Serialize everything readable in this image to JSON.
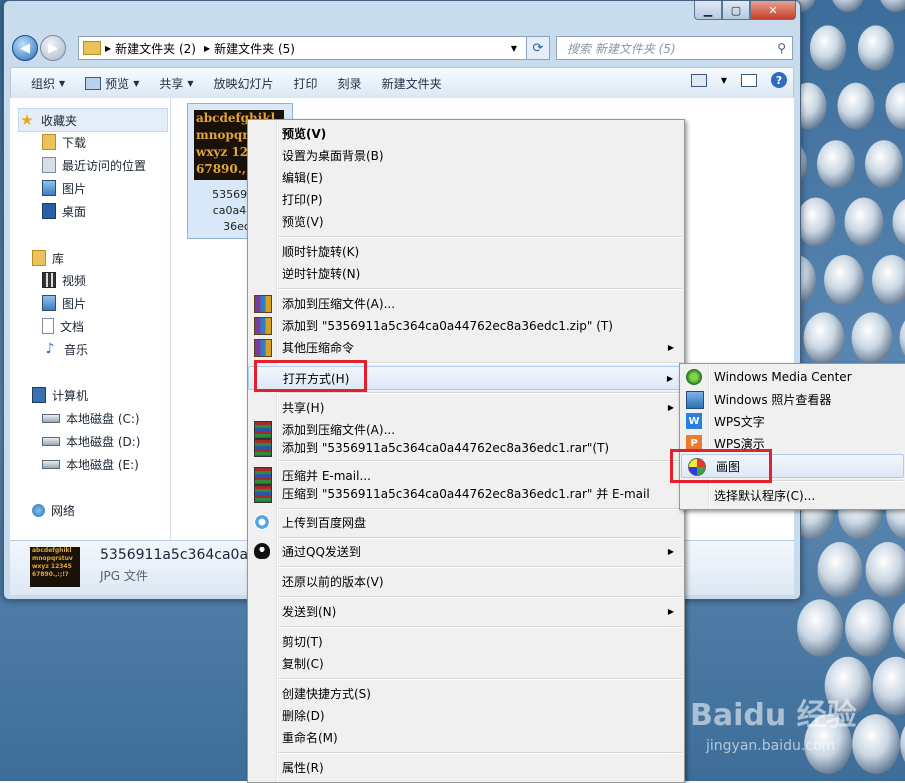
{
  "address": {
    "segments": [
      "新建文件夹 (2)",
      "新建文件夹 (5)"
    ]
  },
  "search": {
    "placeholder": "搜索 新建文件夹 (5)"
  },
  "toolbar": {
    "organize": "组织",
    "preview": "预览",
    "share": "共享",
    "slideshow": "放映幻灯片",
    "print": "打印",
    "burn": "刻录",
    "new_folder": "新建文件夹"
  },
  "sidebar": {
    "favorites": "收藏夹",
    "downloads": "下载",
    "recent": "最近访问的位置",
    "pictures_fav": "图片",
    "desktop": "桌面",
    "libraries": "库",
    "videos": "视频",
    "pictures": "图片",
    "documents": "文档",
    "music": "音乐",
    "computer": "计算机",
    "disk_c": "本地磁盘 (C:)",
    "disk_d": "本地磁盘 (D:)",
    "disk_e": "本地磁盘 (E:)",
    "network": "网络"
  },
  "file": {
    "thumb_lines": [
      "abcdefghikl",
      "mnopqrst",
      "wxyz 123",
      "67890.,"
    ],
    "name_lines": [
      "5356911a",
      "ca0a4476",
      "36edc"
    ]
  },
  "details": {
    "thumb_lines": [
      "abcdefghikl",
      "mnopqrstuv",
      "wxyz 12345",
      "67890.,:;!?"
    ],
    "name": "5356911a5c364ca0a447",
    "type": "JPG 文件"
  },
  "menu": {
    "preview_bold": "预览(V)",
    "set_desktop_bg": "设置为桌面背景(B)",
    "edit": "编辑(E)",
    "print": "打印(P)",
    "preview": "预览(V)",
    "rotate_cw": "顺时针旋转(K)",
    "rotate_ccw": "逆时针旋转(N)",
    "add_archive": "添加到压缩文件(A)...",
    "add_zip": "添加到 \"5356911a5c364ca0a44762ec8a36edc1.zip\" (T)",
    "other_compress": "其他压缩命令",
    "open_with": "打开方式(H)",
    "share": "共享(H)",
    "add_archive2": "添加到压缩文件(A)...",
    "add_rar": "添加到 \"5356911a5c364ca0a44762ec8a36edc1.rar\"(T)",
    "compress_email": "压缩并 E-mail...",
    "compress_rar_email": "压缩到 \"5356911a5c364ca0a44762ec8a36edc1.rar\" 并 E-mail",
    "upload_baidu": "上传到百度网盘",
    "send_qq": "通过QQ发送到",
    "restore": "还原以前的版本(V)",
    "send_to": "发送到(N)",
    "cut": "剪切(T)",
    "copy": "复制(C)",
    "create_shortcut": "创建快捷方式(S)",
    "delete": "删除(D)",
    "rename": "重命名(M)",
    "properties": "属性(R)"
  },
  "submenu": {
    "wmc": "Windows Media Center",
    "photo_viewer": "Windows 照片查看器",
    "wps_writer": "WPS文字",
    "wps_presentation": "WPS演示",
    "paint": "画图",
    "choose_default": "选择默认程序(C)..."
  },
  "watermark": {
    "brand": "Baidu 经验",
    "url": "jingyan.baidu.com"
  },
  "colors": {
    "highlight_box": "#e5202a",
    "hover_bg": "#dce8f6"
  }
}
